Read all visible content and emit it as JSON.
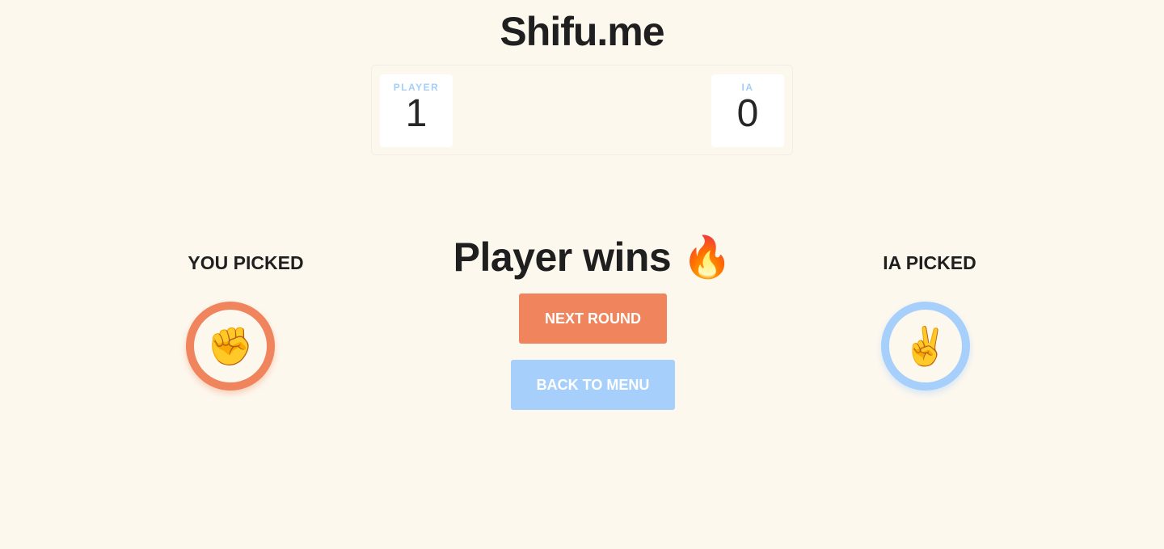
{
  "app": {
    "title": "Shifu.me"
  },
  "scoreboard": {
    "player": {
      "label": "PLAYER",
      "score": "1"
    },
    "ia": {
      "label": "IA",
      "score": "0"
    }
  },
  "player_pick": {
    "label": "YOU PICKED",
    "emoji": "✊",
    "icon": "rock-fist-icon"
  },
  "ia_pick": {
    "label": "IA PICKED",
    "emoji": "✌️",
    "icon": "scissors-victory-hand-icon"
  },
  "result": {
    "text": "Player wins 🔥"
  },
  "buttons": {
    "next_round": "NEXT ROUND",
    "back_to_menu": "BACK TO MENU"
  },
  "colors": {
    "background": "#fdf8ee",
    "player_accent": "#f0845c",
    "ia_accent": "#a6d0fb",
    "text": "#1f1f1f"
  }
}
